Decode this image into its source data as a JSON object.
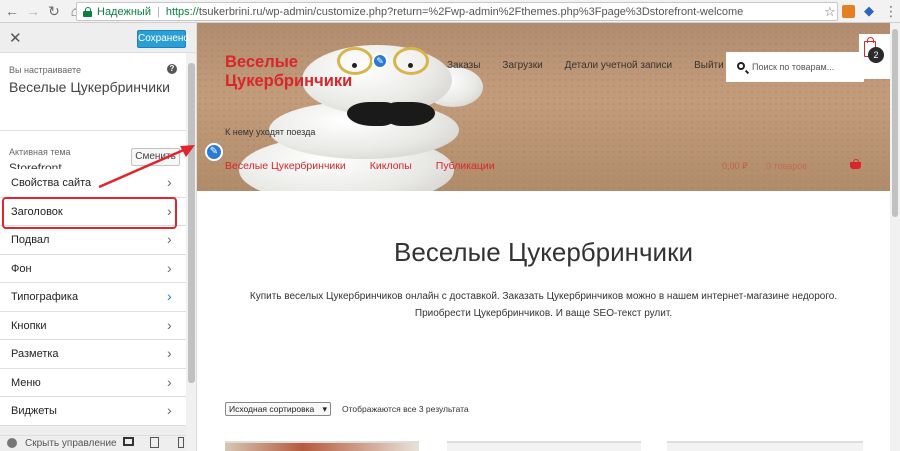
{
  "browser": {
    "secure_label": "Надежный",
    "url_scheme": "https://",
    "url_rest": "tsukerbrini.ru/wp-admin/customize.php?return=%2Fwp-admin%2Fthemes.php%3Fpage%3Dstorefront-welcome",
    "icons": [
      "back-arrow-icon",
      "forward-arrow-icon",
      "reload-icon",
      "home-icon",
      "lock-icon",
      "star-icon",
      "menu-icon"
    ]
  },
  "panel": {
    "close": "✕",
    "save_label": "Сохранено",
    "customizing_label": "Вы настраиваете",
    "site_title": "Веселые Цукербринчики",
    "help": "?",
    "active_theme_label": "Активная тема",
    "theme_name": "Storefront",
    "change_button": "Сменить",
    "sections": [
      {
        "label": "Свойства сайта"
      },
      {
        "label": "Заголовок"
      },
      {
        "label": "Подвал"
      },
      {
        "label": "Фон"
      },
      {
        "label": "Типографика"
      },
      {
        "label": "Кнопки"
      },
      {
        "label": "Разметка"
      },
      {
        "label": "Меню"
      },
      {
        "label": "Виджеты"
      }
    ],
    "footer_label": "Скрыть управление",
    "highlight_color": "#e0262c"
  },
  "preview": {
    "site_name": "Веселые Цукербринчики",
    "tagline": "К нему уходят поезда",
    "secondary_nav": [
      "Заказы",
      "Загрузки",
      "Детали учетной записи",
      "Выйти"
    ],
    "search_placeholder": "Поиск по товарам...",
    "cart_count": "2",
    "primary_nav": [
      "Веселые Цукербринчики",
      "Киклопы",
      "Публикации"
    ],
    "nav_faded_1": "0,00 ₽",
    "nav_faded_2": "0 товаров",
    "heading": "Веселые Цукербринчики",
    "intro": "Купить веселых Цукербринчиков онлайн с доставкой. Заказать Цукербринчиков можно в нашем интернет-магазине недорого. Приобрести Цукербринчиков. И ваще SEO-текст рулит.",
    "sort_value": "Исходная сортировка",
    "results": "Отображаются все 3 результата",
    "accent_color": "#d8262c"
  }
}
